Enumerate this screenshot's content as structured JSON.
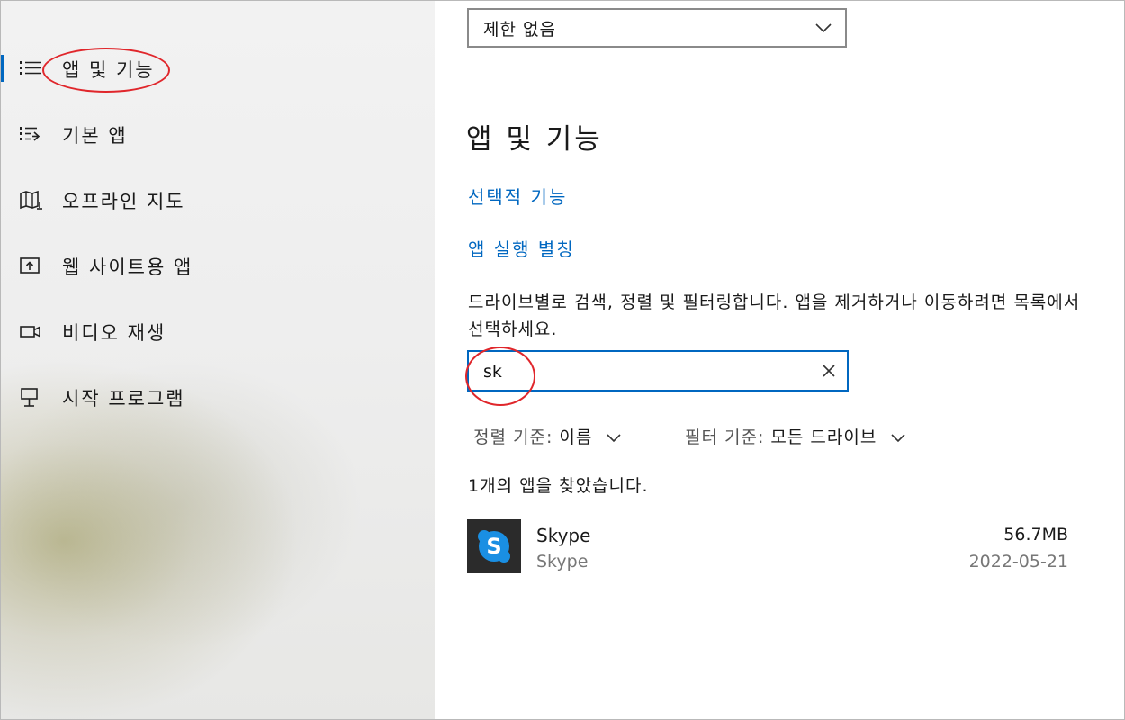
{
  "sidebar": {
    "items": [
      {
        "label": "앱 및 기능",
        "icon": "apps-features-icon",
        "selected": true
      },
      {
        "label": "기본 앱",
        "icon": "default-apps-icon",
        "selected": false
      },
      {
        "label": "오프라인 지도",
        "icon": "offline-maps-icon",
        "selected": false
      },
      {
        "label": "웹 사이트용 앱",
        "icon": "apps-for-websites-icon",
        "selected": false
      },
      {
        "label": "비디오 재생",
        "icon": "video-playback-icon",
        "selected": false
      },
      {
        "label": "시작 프로그램",
        "icon": "startup-icon",
        "selected": false
      }
    ]
  },
  "main": {
    "restriction_dropdown": {
      "value": "제한 없음"
    },
    "section_title": "앱 및 기능",
    "links": {
      "optional_features": "선택적 기능",
      "app_execution_aliases": "앱 실행 별칭"
    },
    "description": "드라이브별로 검색, 정렬 및 필터링합니다. 앱을 제거하거나 이동하려면 목록에서 선택하세요.",
    "search": {
      "value": "sk"
    },
    "sort": {
      "label": "정렬 기준:",
      "value": "이름"
    },
    "filter": {
      "label": "필터 기준:",
      "value": "모든 드라이브"
    },
    "result_count": "1개의 앱을 찾았습니다.",
    "apps": [
      {
        "name": "Skype",
        "publisher": "Skype",
        "size": "56.7MB",
        "date": "2022-05-21",
        "icon": "skype-icon"
      }
    ]
  },
  "colors": {
    "accent": "#0067c0",
    "annotation": "#e0262b",
    "skype_blue": "#1a8fe3"
  }
}
